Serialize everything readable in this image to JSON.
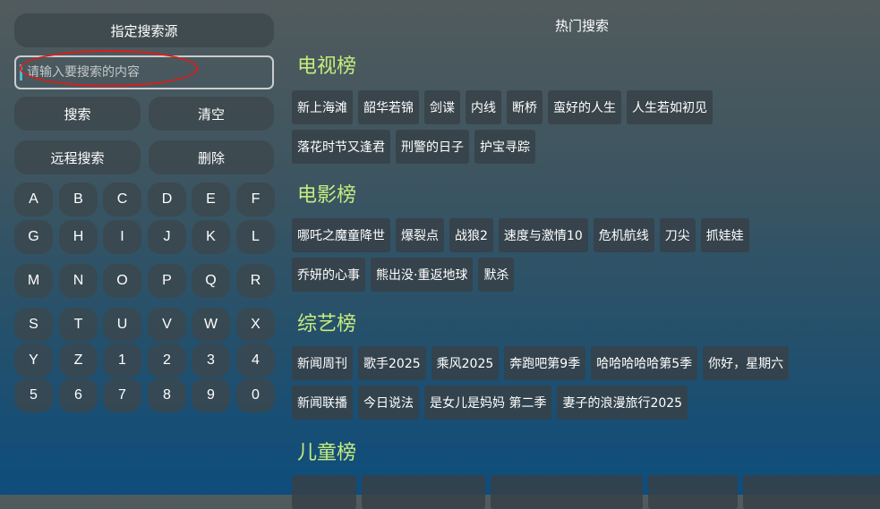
{
  "left": {
    "source_button": "指定搜索源",
    "search_placeholder": "请输入要搜索的内容",
    "search_button": "搜索",
    "clear_button": "清空",
    "remote_button": "远程搜索",
    "delete_button": "删除",
    "keys": [
      "A",
      "B",
      "C",
      "D",
      "E",
      "F",
      "G",
      "H",
      "I",
      "J",
      "K",
      "L",
      "M",
      "N",
      "O",
      "P",
      "Q",
      "R",
      "S",
      "T",
      "U",
      "V",
      "W",
      "X",
      "Y",
      "Z",
      "1",
      "2",
      "3",
      "4",
      "5",
      "6",
      "7",
      "8",
      "9",
      "0"
    ]
  },
  "right": {
    "title": "热门搜索",
    "categories": [
      {
        "title": "电视榜",
        "rows": [
          [
            "新上海滩",
            "韶华若锦",
            "剑谍",
            "内线",
            "断桥",
            "蛮好的人生",
            "人生若如初见"
          ],
          [
            "落花时节又逢君",
            "刑警的日子",
            "护宝寻踪"
          ]
        ]
      },
      {
        "title": "电影榜",
        "rows": [
          [
            "哪吒之魔童降世",
            "爆裂点",
            "战狼2",
            "速度与激情10",
            "危机航线",
            "刀尖",
            "抓娃娃"
          ],
          [
            "乔妍的心事",
            "熊出没·重返地球",
            "默杀"
          ]
        ]
      },
      {
        "title": "综艺榜",
        "rows": [
          [
            "新闻周刊",
            "歌手2025",
            "乘风2025",
            "奔跑吧第9季",
            "哈哈哈哈哈第5季",
            "你好，星期六"
          ],
          [
            "新闻联播",
            "今日说法",
            "是女儿是妈妈 第二季",
            "妻子的浪漫旅行2025"
          ]
        ]
      },
      {
        "title": "儿童榜",
        "rows": []
      }
    ]
  },
  "colors": {
    "category_title": "#c6ec7e",
    "annotation_ellipse": "#e11a1a",
    "caret": "#4fb8d0"
  }
}
